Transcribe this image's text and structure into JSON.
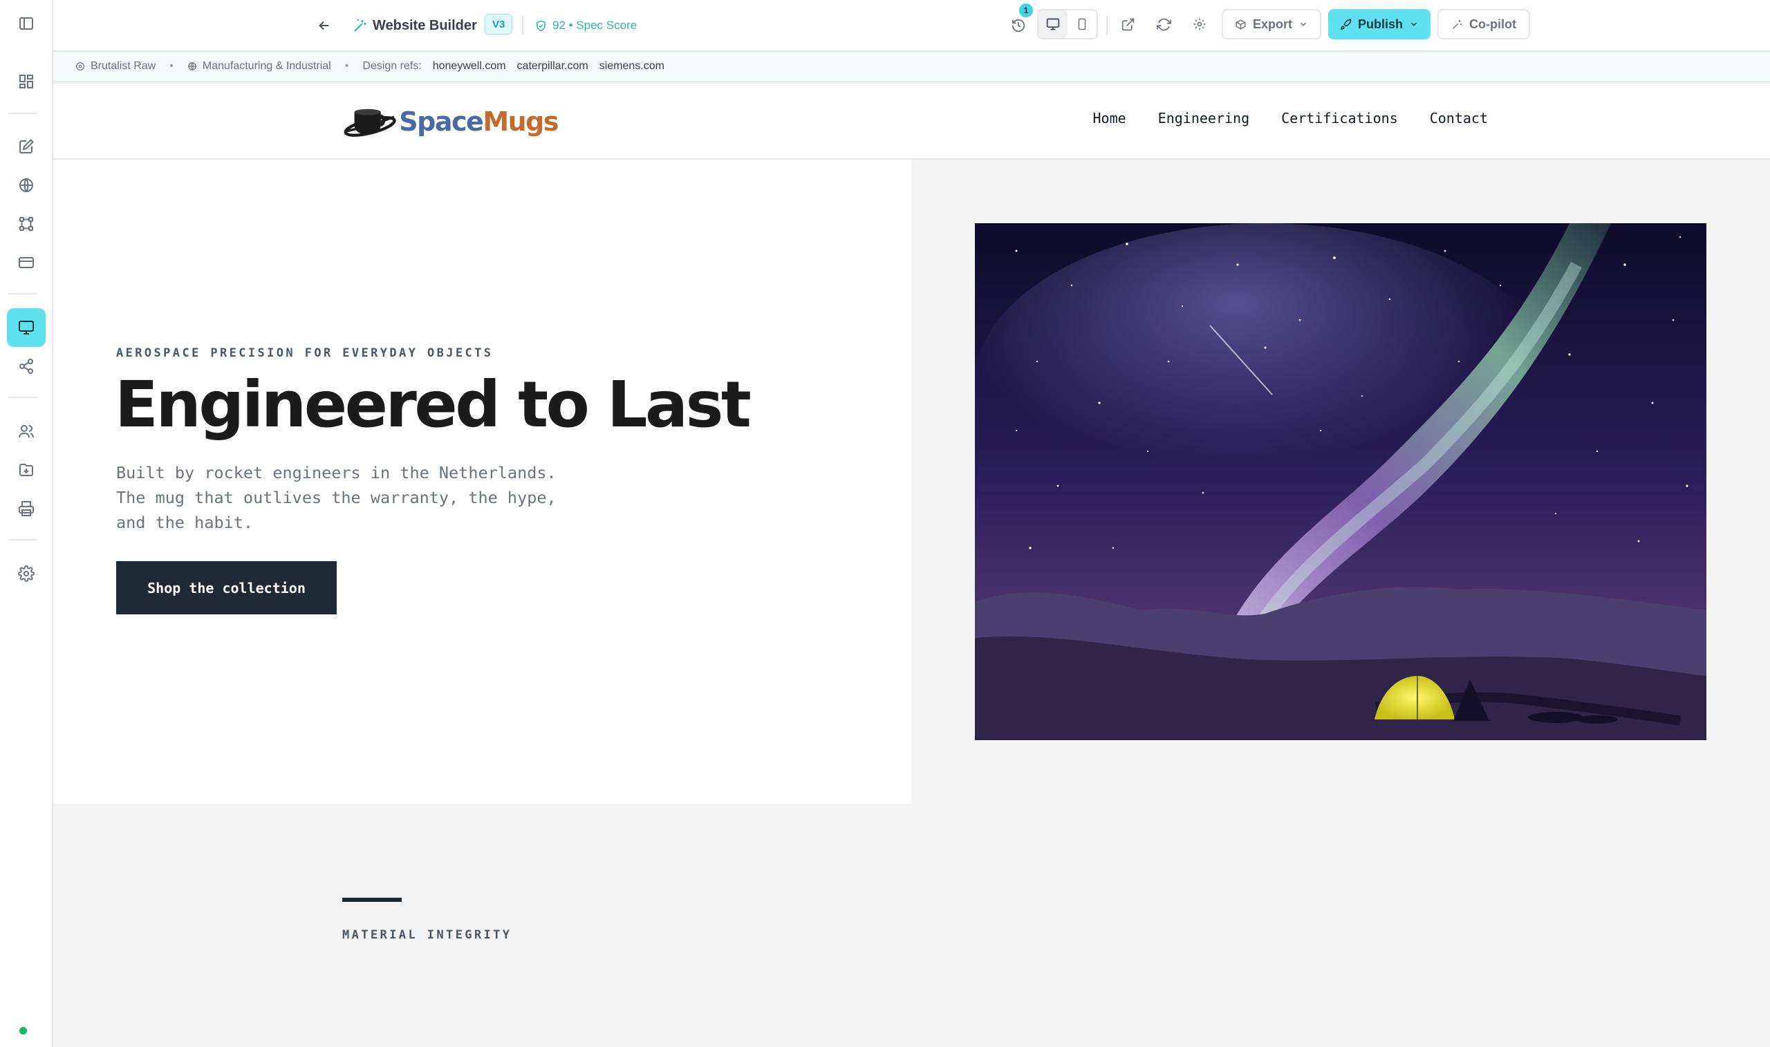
{
  "app": {
    "title": "Website Builder",
    "version": "V3",
    "spec_score": "92 • Spec Score",
    "history_count": "1",
    "export_label": "Export",
    "publish_label": "Publish",
    "copilot_label": "Co-pilot",
    "accent": "#5fe1f0"
  },
  "meta": {
    "style": "Brutalist Raw",
    "industry": "Manufacturing & Industrial",
    "refs_label": "Design refs:",
    "refs": [
      "honeywell.com",
      "caterpillar.com",
      "siemens.com"
    ]
  },
  "rail": {
    "icons": [
      "sidebar-toggle-icon",
      "dashboard-icon",
      "edit-icon",
      "globe-icon",
      "flow-icon",
      "card-icon",
      "monitor-icon",
      "share-icon",
      "users-icon",
      "folder-download-icon",
      "printer-icon",
      "gear-icon"
    ],
    "active": "monitor-icon"
  },
  "site": {
    "logo": {
      "part1": "Space",
      "part2": "Mugs"
    },
    "nav": [
      "Home",
      "Engineering",
      "Certifications",
      "Contact"
    ],
    "hero": {
      "eyebrow": "AEROSPACE PRECISION FOR EVERYDAY OBJECTS",
      "title": "Engineered to Last",
      "subtitle": "Built by rocket engineers in the Netherlands. The mug that outlives the warranty, the hype, and the habit.",
      "cta": "Shop the collection"
    },
    "section2": {
      "eyebrow": "MATERIAL INTEGRITY"
    }
  }
}
